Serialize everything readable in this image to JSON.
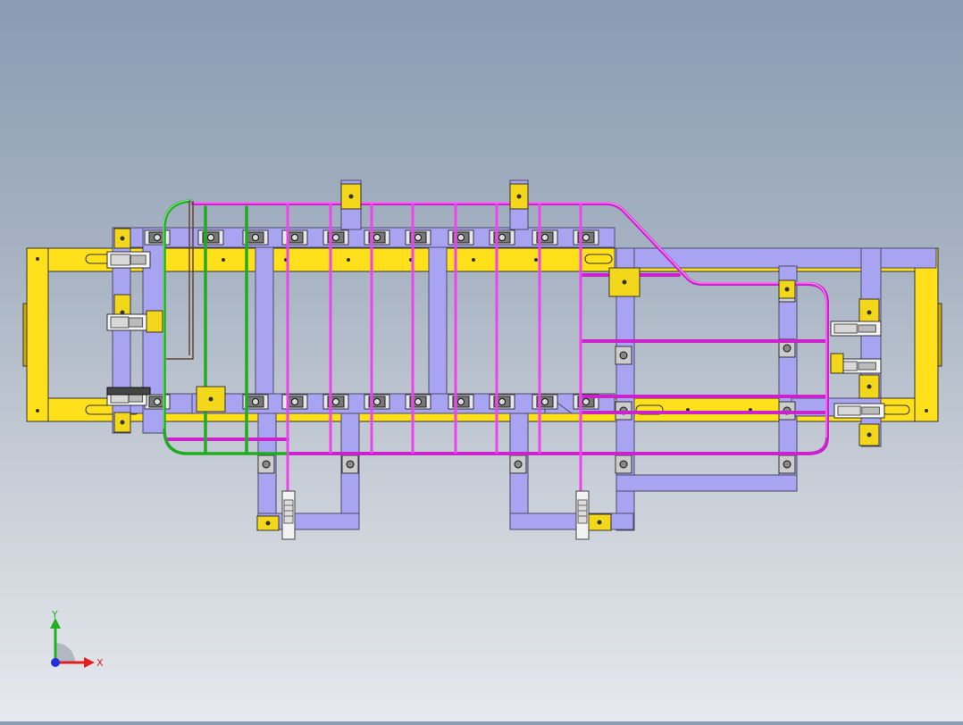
{
  "viewport": {
    "name": "cad-3d-viewport",
    "colors": {
      "frame": "#ffe01a",
      "frame_edge": "#333333",
      "beam": "#a8a4f2",
      "beam_edge": "#4a4a66",
      "pipe_magenta": "#ee44ee",
      "pipe_green": "#33cc33",
      "clamp_yellow": "#f3d71a",
      "clamp_white": "#f4f4f4",
      "mount_dark": "#666666"
    }
  },
  "triad": {
    "x_label": "X",
    "y_label": "Y",
    "colors": {
      "x": "#e02020",
      "y": "#20b020",
      "z": "#2030e0"
    }
  }
}
